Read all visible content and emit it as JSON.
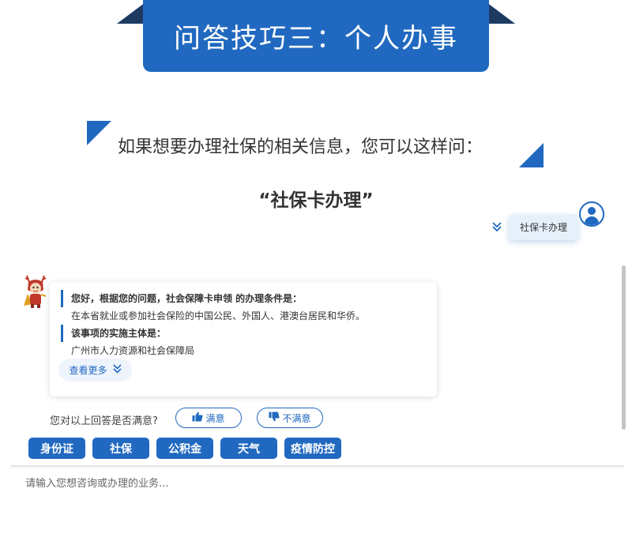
{
  "banner": {
    "title": "问答技巧三：个人办事"
  },
  "intro": {
    "text": "如果想要办理社保的相关信息，您可以这样问：",
    "query": "“社保卡办理”"
  },
  "chat": {
    "user_message": "社保卡办理",
    "bot_answer": {
      "lines": [
        "您好，根据您的问题，社会保障卡申领 的办理条件是：",
        "在本省就业或参加社会保险的中国公民、外国人、港澳台居民和华侨。",
        "该事项的实施主体是：",
        "广州市人力资源和社会保障局"
      ],
      "more_label": "查看更多"
    },
    "feedback": {
      "question": "您对以上回答是否满意?",
      "satisfied": "满意",
      "unsatisfied": "不满意"
    },
    "quick_chips": [
      "身份证",
      "社保",
      "公积金",
      "天气",
      "疫情防控"
    ],
    "input": {
      "placeholder": "请输入您想咨询或办理的业务..."
    }
  },
  "icons": {
    "user_avatar": "user-avatar-icon",
    "expand": "chevron-double-down-icon",
    "more": "chevron-double-down-icon",
    "like": "thumbs-up-icon",
    "dislike": "thumbs-down-icon",
    "mascot": "mascot-icon"
  },
  "colors": {
    "primary": "#2169c0",
    "dark_wing": "#1d3a63",
    "bubble": "#e6f0fb"
  }
}
